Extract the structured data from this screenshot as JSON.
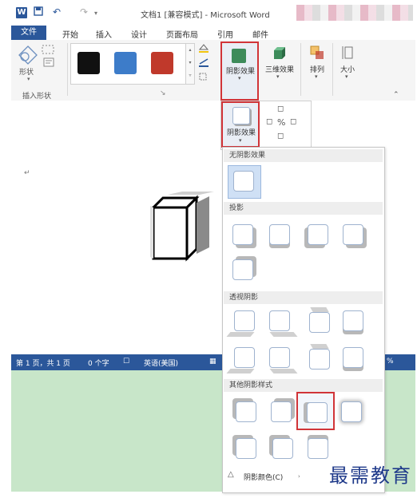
{
  "titlebar": {
    "logo": "W",
    "undo_glyph": "↶",
    "redo_glyph": "↷",
    "title": "文档1 [兼容模式] - Microsoft Word"
  },
  "tabs": [
    {
      "label": "文件"
    },
    {
      "label": "开始"
    },
    {
      "label": "插入"
    },
    {
      "label": "设计"
    },
    {
      "label": "页面布局"
    },
    {
      "label": "引用"
    },
    {
      "label": "邮件"
    }
  ],
  "ribbon": {
    "shapes_label": "形状",
    "insert_shapes_group": "插入形状",
    "swatches": [
      "#111111",
      "#3d7cc9",
      "#c0392b"
    ],
    "shadow_effects_label": "阴影效果",
    "threed_effects_label": "三维效果",
    "arrange_label": "排列",
    "size_label": "大小",
    "fold_glyph": "⌃",
    "dialog_glyph": "↘"
  },
  "subribbon": {
    "shadow_effects_label": "阴影效果"
  },
  "statusbar": {
    "page": "第 1 页，共 1 页",
    "words": "0 个字",
    "language": "英语(美国)",
    "percent": "%"
  },
  "popup": {
    "no_shadow": "无阴影效果",
    "drop_shadow": "投影",
    "perspective_shadow": "透视阴影",
    "other_styles": "其他阴影样式",
    "shadow_color": "阴影颜色(C)"
  },
  "watermark": "最需教育",
  "colors": {
    "accent": "#2b579a",
    "highlight": "#d13438",
    "statusbar_green": "#c8e6c9"
  }
}
